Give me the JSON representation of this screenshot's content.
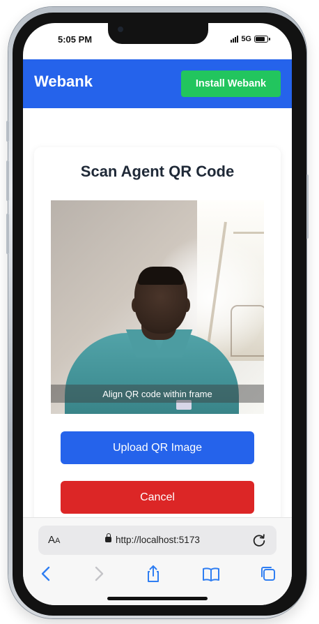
{
  "status_bar": {
    "time": "5:05 PM",
    "network": "5G",
    "battery_level": 0.9
  },
  "app": {
    "brand": "Webank",
    "install_label": "Install Webank",
    "colors": {
      "primary": "#2563eb",
      "install": "#22c55e",
      "danger": "#dc2626"
    }
  },
  "scan": {
    "title": "Scan Agent QR Code",
    "align_hint": "Align QR code within frame",
    "upload_label": "Upload QR Image",
    "cancel_label": "Cancel"
  },
  "browser": {
    "aa_label": "A",
    "aa_small": "A",
    "url": "http://localhost:5173",
    "icons": [
      "back-icon",
      "forward-icon",
      "share-icon",
      "bookmarks-icon",
      "tabs-icon",
      "reload-icon",
      "lock-icon"
    ]
  }
}
